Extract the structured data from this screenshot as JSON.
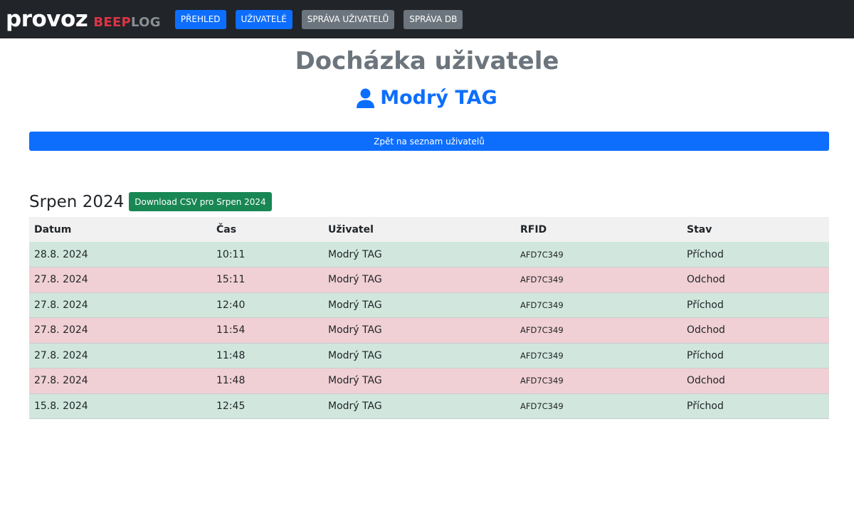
{
  "navbar": {
    "brand_main": "provoz",
    "brand_beep": "BEEP",
    "brand_log": "LOG",
    "items": [
      {
        "label": "PŘEHLED",
        "style": "primary"
      },
      {
        "label": "UŽIVATELÉ",
        "style": "primary"
      },
      {
        "label": "SPRÁVA UŽIVATELŮ",
        "style": "secondary"
      },
      {
        "label": "SPRÁVA DB",
        "style": "secondary"
      }
    ]
  },
  "page": {
    "title": "Docházka uživatele",
    "user_name": "Modrý TAG",
    "user_icon": "user-icon",
    "back_label": "Zpět na seznam uživatelů"
  },
  "month": {
    "title": "Srpen 2024",
    "csv_label": "Download CSV pro Srpen 2024"
  },
  "table": {
    "headers": [
      "Datum",
      "Čas",
      "Uživatel",
      "RFID",
      "Stav"
    ],
    "rows": [
      {
        "date": "28.8. 2024",
        "time": "10:11",
        "user": "Modrý TAG",
        "rfid": "AFD7C349",
        "status": "Příchod",
        "type": "in"
      },
      {
        "date": "27.8. 2024",
        "time": "15:11",
        "user": "Modrý TAG",
        "rfid": "AFD7C349",
        "status": "Odchod",
        "type": "out"
      },
      {
        "date": "27.8. 2024",
        "time": "12:40",
        "user": "Modrý TAG",
        "rfid": "AFD7C349",
        "status": "Příchod",
        "type": "in"
      },
      {
        "date": "27.8. 2024",
        "time": "11:54",
        "user": "Modrý TAG",
        "rfid": "AFD7C349",
        "status": "Odchod",
        "type": "out"
      },
      {
        "date": "27.8. 2024",
        "time": "11:48",
        "user": "Modrý TAG",
        "rfid": "AFD7C349",
        "status": "Příchod",
        "type": "in"
      },
      {
        "date": "27.8. 2024",
        "time": "11:48",
        "user": "Modrý TAG",
        "rfid": "AFD7C349",
        "status": "Odchod",
        "type": "out"
      },
      {
        "date": "15.8. 2024",
        "time": "12:45",
        "user": "Modrý TAG",
        "rfid": "AFD7C349",
        "status": "Příchod",
        "type": "in"
      }
    ]
  },
  "colors": {
    "navbar_bg": "#212529",
    "primary": "#0d6efd",
    "secondary": "#6c757d",
    "success": "#198754",
    "row_in": "#d1e7dd",
    "row_out": "#f0d0d4"
  }
}
